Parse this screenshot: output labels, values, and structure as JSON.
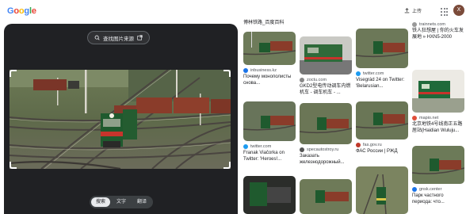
{
  "header": {
    "logo_letters": [
      "G",
      "o",
      "o",
      "g",
      "l",
      "e"
    ],
    "upload_label": "上传",
    "avatar_letter": "X"
  },
  "viewer": {
    "find_source_label": "查找图片来源",
    "modes": [
      "搜索",
      "文字",
      "翻译"
    ],
    "active_mode": "搜索"
  },
  "results": {
    "col1": [
      {
        "source": "",
        "title": "博林铁路_百度百科"
      },
      {
        "source": "inbusiness.kz",
        "title": "Почему монополисты снова..."
      },
      {
        "source": "twitter.com",
        "title": "Franak Viačorka on Twitter: 'Heroes!..."
      },
      {
        "source": "",
        "title": ""
      }
    ],
    "col2": [
      {
        "source": "zoctu.com",
        "title": "GKD2型电传动调车内燃机车 - 调车机车 - ..."
      },
      {
        "source": "specautostroy.ru",
        "title": "Заказать железнодорожный..."
      },
      {
        "source": "",
        "title": ""
      }
    ],
    "col3": [
      {
        "source": "twitter.com",
        "title": "Visegrád 24 on Twitter: 'Belarusian..."
      },
      {
        "source": "fas.gov.ru",
        "title": "ФАС России | РЖД"
      },
      {
        "source": "",
        "title": ""
      }
    ],
    "col4": [
      {
        "source": "trainnets.com",
        "title": "铁人狂想屋 | 你的火车发展地 » HXN5-2000"
      },
      {
        "source": "mapio.net",
        "title": "北京地铁4号线南正五路居站(Haidian Wuluju..."
      },
      {
        "source": "gnsk.center",
        "title": "Парк частного периода: что..."
      }
    ]
  },
  "colors": {
    "logo": [
      "#4285F4",
      "#EA4335",
      "#FBBC05",
      "#4285F4",
      "#34A853",
      "#EA4335"
    ],
    "viewer_bg": "#202124",
    "locomotive": "#1f5a2e"
  }
}
